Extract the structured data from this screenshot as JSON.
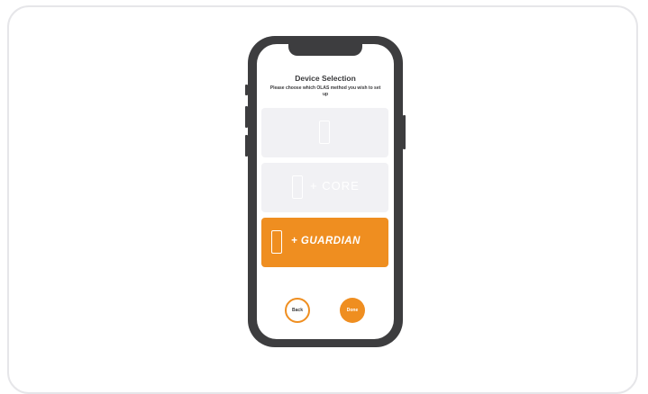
{
  "screen": {
    "title": "Device Selection",
    "subtitle": "Please choose which OLAS method you wish to set up"
  },
  "options": [
    {
      "icon": "phone-outline-icon",
      "label": "",
      "selected": false
    },
    {
      "icon": "phone-outline-icon",
      "label": "+ CORE",
      "selected": false
    },
    {
      "icon": "phone-outline-icon",
      "label": "+ GUARDIAN",
      "selected": true
    }
  ],
  "buttons": {
    "back_label": "Back",
    "done_label": "Done"
  },
  "colors": {
    "accent": "#ef8e20",
    "option_bg": "#f1f1f4",
    "phone_body": "#3d3d3f",
    "text_dark": "#3a3a3c"
  }
}
